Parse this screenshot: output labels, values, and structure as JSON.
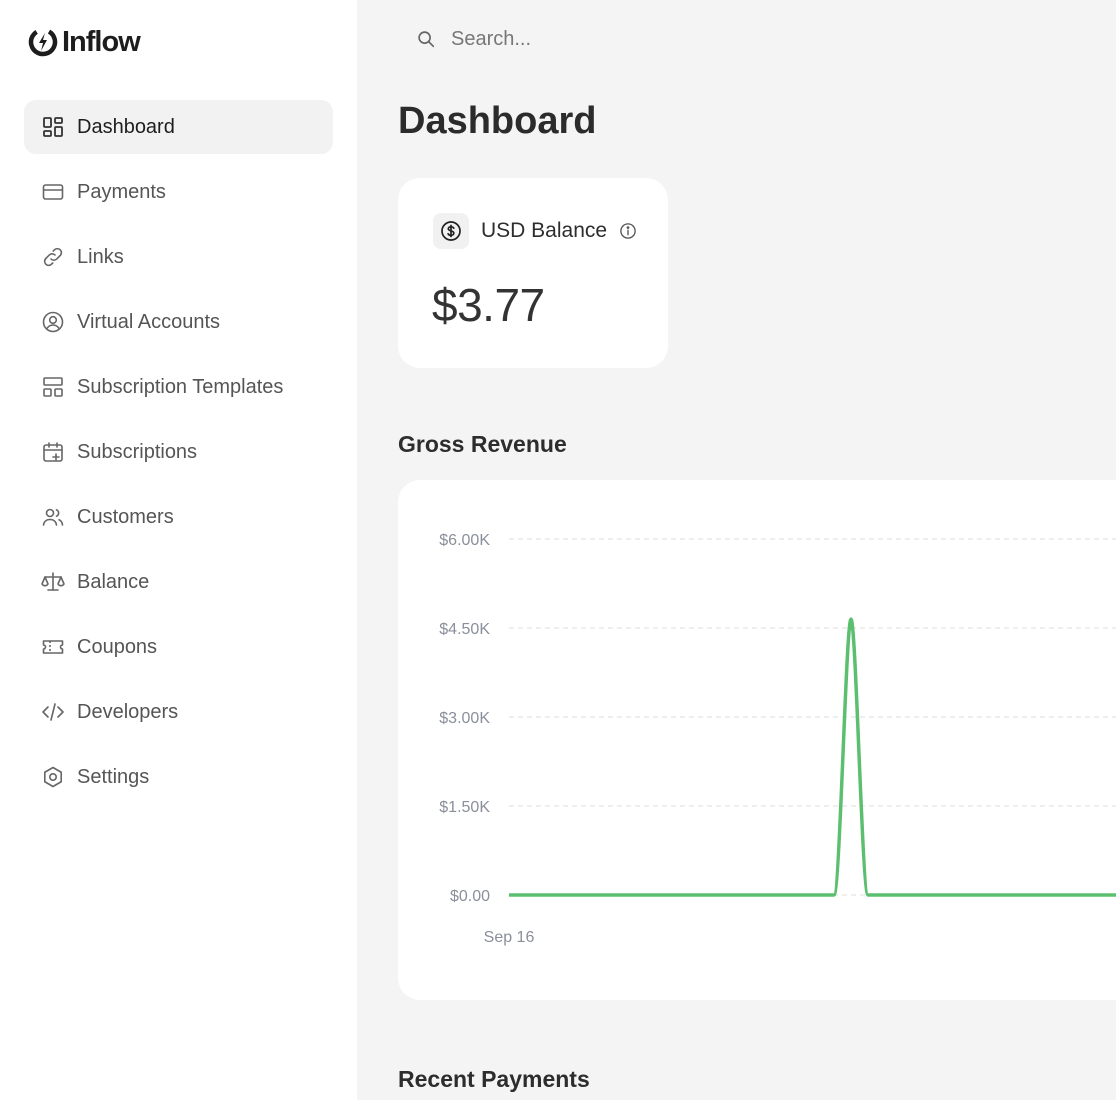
{
  "brand": {
    "name": "Inflow"
  },
  "sidebar": {
    "items": [
      {
        "label": "Dashboard",
        "icon": "dashboard-icon",
        "active": true
      },
      {
        "label": "Payments",
        "icon": "credit-card-icon"
      },
      {
        "label": "Links",
        "icon": "link-icon"
      },
      {
        "label": "Virtual Accounts",
        "icon": "user-circle-icon"
      },
      {
        "label": "Subscription Templates",
        "icon": "template-icon"
      },
      {
        "label": "Subscriptions",
        "icon": "calendar-plus-icon"
      },
      {
        "label": "Customers",
        "icon": "users-icon"
      },
      {
        "label": "Balance",
        "icon": "scale-icon"
      },
      {
        "label": "Coupons",
        "icon": "ticket-icon"
      },
      {
        "label": "Developers",
        "icon": "code-icon"
      },
      {
        "label": "Settings",
        "icon": "settings-icon"
      }
    ]
  },
  "search": {
    "placeholder": "Search..."
  },
  "page": {
    "title": "Dashboard"
  },
  "balance": {
    "label": "USD Balance",
    "amount": "$3.77"
  },
  "gross_revenue": {
    "title": "Gross Revenue"
  },
  "recent_payments": {
    "title": "Recent Payments"
  },
  "colors": {
    "accent_line": "#5cbf6f",
    "grid": "#dcdcdc",
    "axis_text": "#8a8f9a"
  },
  "chart_data": {
    "type": "line",
    "x_tick_labels": [
      "Sep 16"
    ],
    "y_tick_labels": [
      "$6.00K",
      "$4.50K",
      "$3.00K",
      "$1.50K",
      "$0.00"
    ],
    "ylim": [
      0,
      6000
    ],
    "series": [
      {
        "values": [
          0,
          0,
          0,
          0,
          0,
          0,
          4650,
          0,
          0,
          0,
          0,
          0,
          0,
          0,
          0,
          0,
          0,
          0
        ]
      }
    ],
    "grid": "dashed horizontal"
  }
}
